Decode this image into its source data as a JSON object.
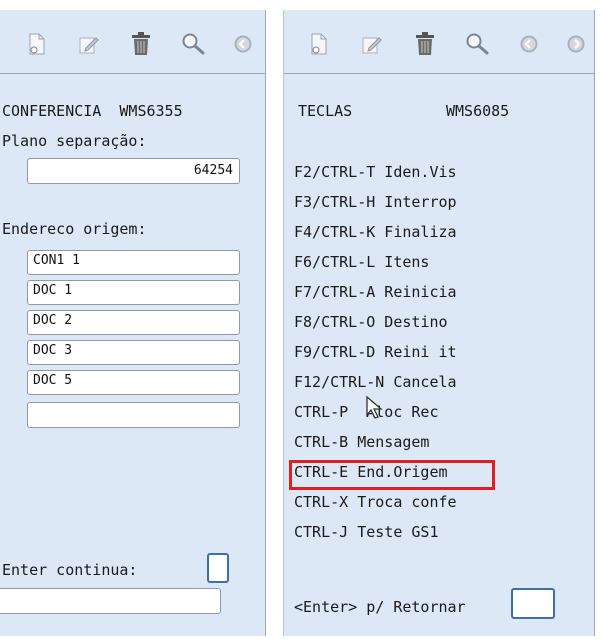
{
  "left": {
    "title": "CONFERENCIA  WMS6355",
    "plano_label": "Plano separação:",
    "plano_value": "64254",
    "endereco_label": "Endereco origem:",
    "enderecos": [
      "CON1 1",
      "DOC 1",
      "DOC 2",
      "DOC 3",
      "DOC 5",
      ""
    ],
    "enter_label": "Enter continua:",
    "enter_value": "",
    "bottom_value": ""
  },
  "right": {
    "title_left": "TECLAS",
    "title_right": "WMS6085",
    "keys": [
      "F2/CTRL-T Iden.Vis",
      "F3/CTRL-H Interrop",
      "F4/CTRL-K Finaliza",
      "F6/CTRL-L Itens",
      "F7/CTRL-A Reinicia",
      "F8/CTRL-O Destino",
      "F9/CTRL-D Reini it",
      "F12/CTRL-N Cancela",
      "CTRL-P  Aloc Rec",
      "CTRL-B Mensagem",
      "CTRL-E End.Origem",
      "CTRL-X Troca confe",
      "CTRL-J Teste GS1"
    ],
    "return_label": "<Enter> p/ Retornar",
    "return_value": ""
  },
  "colors": {
    "panel_bg": "#dde8f6",
    "highlight": "#e02020"
  },
  "icons": [
    "new-document-icon",
    "edit-icon",
    "trash-icon",
    "search-icon",
    "back-icon",
    "forward-icon"
  ]
}
